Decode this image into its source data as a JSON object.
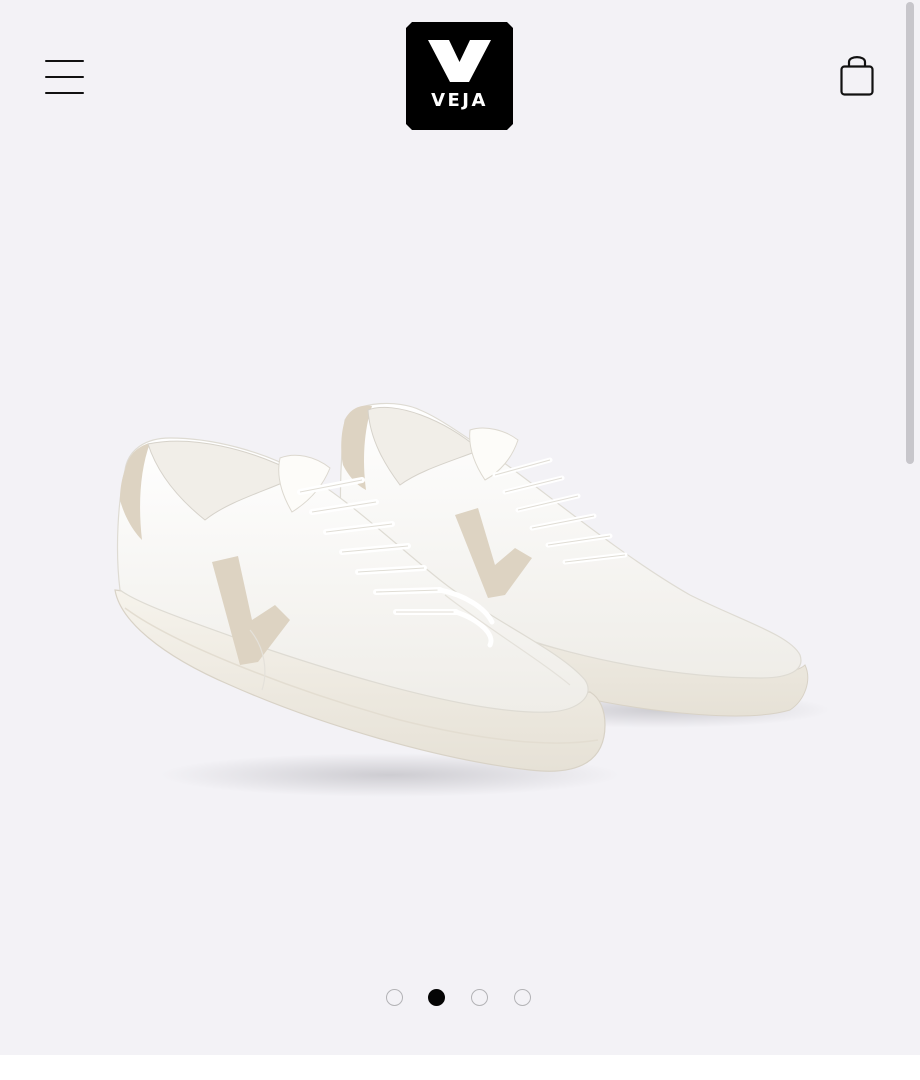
{
  "header": {
    "logo_text": "VEJA"
  },
  "carousel": {
    "slide_count": 4,
    "active_index": 1
  },
  "colors": {
    "background": "#f3f2f6",
    "shoe_leather": "#fbfaf7",
    "suede_accent": "#ddd3c2",
    "active_dot": "#050505",
    "inactive_dot_border": "#b3b3b6"
  },
  "icons": {
    "menu": "hamburger-menu-icon",
    "cart": "shopping-bag-icon"
  }
}
